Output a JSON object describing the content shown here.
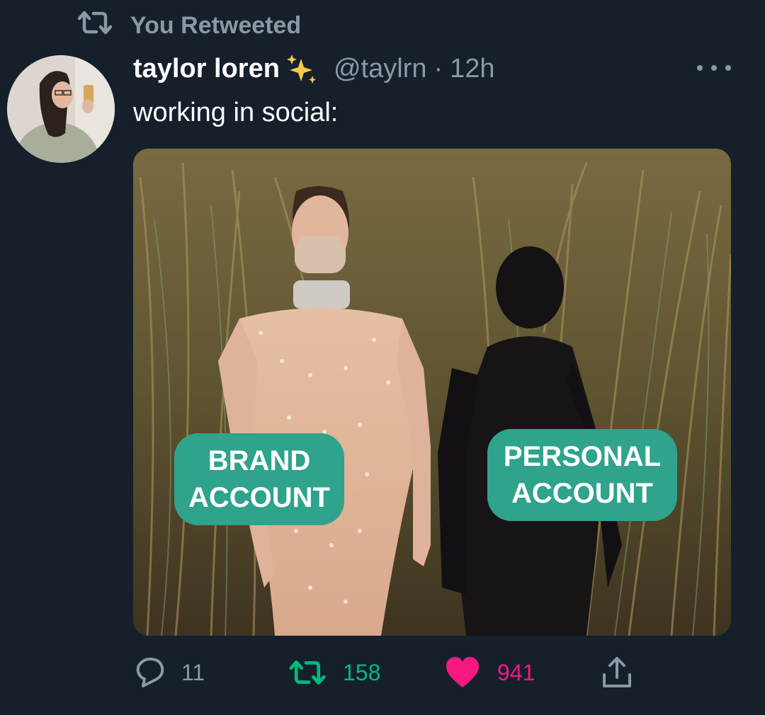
{
  "retweet_context": {
    "icon": "retweet-icon",
    "text": "You Retweeted"
  },
  "tweet": {
    "author": {
      "display_name": "taylor loren",
      "emoji": "✨",
      "handle": "@taylrn",
      "separator": "·",
      "time": "12h"
    },
    "text": "working in social:",
    "more_icon": "more-horizontal-icon",
    "media": {
      "labels": [
        {
          "line1": "BRAND",
          "line2": "ACCOUNT"
        },
        {
          "line1": "PERSONAL",
          "line2": "ACCOUNT"
        }
      ]
    },
    "actions": {
      "reply": {
        "icon": "reply-icon",
        "count": "11"
      },
      "retweet": {
        "icon": "retweet-icon",
        "count": "158",
        "color": "#00ba7c",
        "active": true
      },
      "like": {
        "icon": "heart-icon",
        "count": "941",
        "color": "#f91880",
        "active": true
      },
      "share": {
        "icon": "share-icon"
      }
    }
  },
  "colors": {
    "background": "#15202b",
    "secondary_text": "#8b98a5",
    "label_bg": "#2fa38c"
  }
}
